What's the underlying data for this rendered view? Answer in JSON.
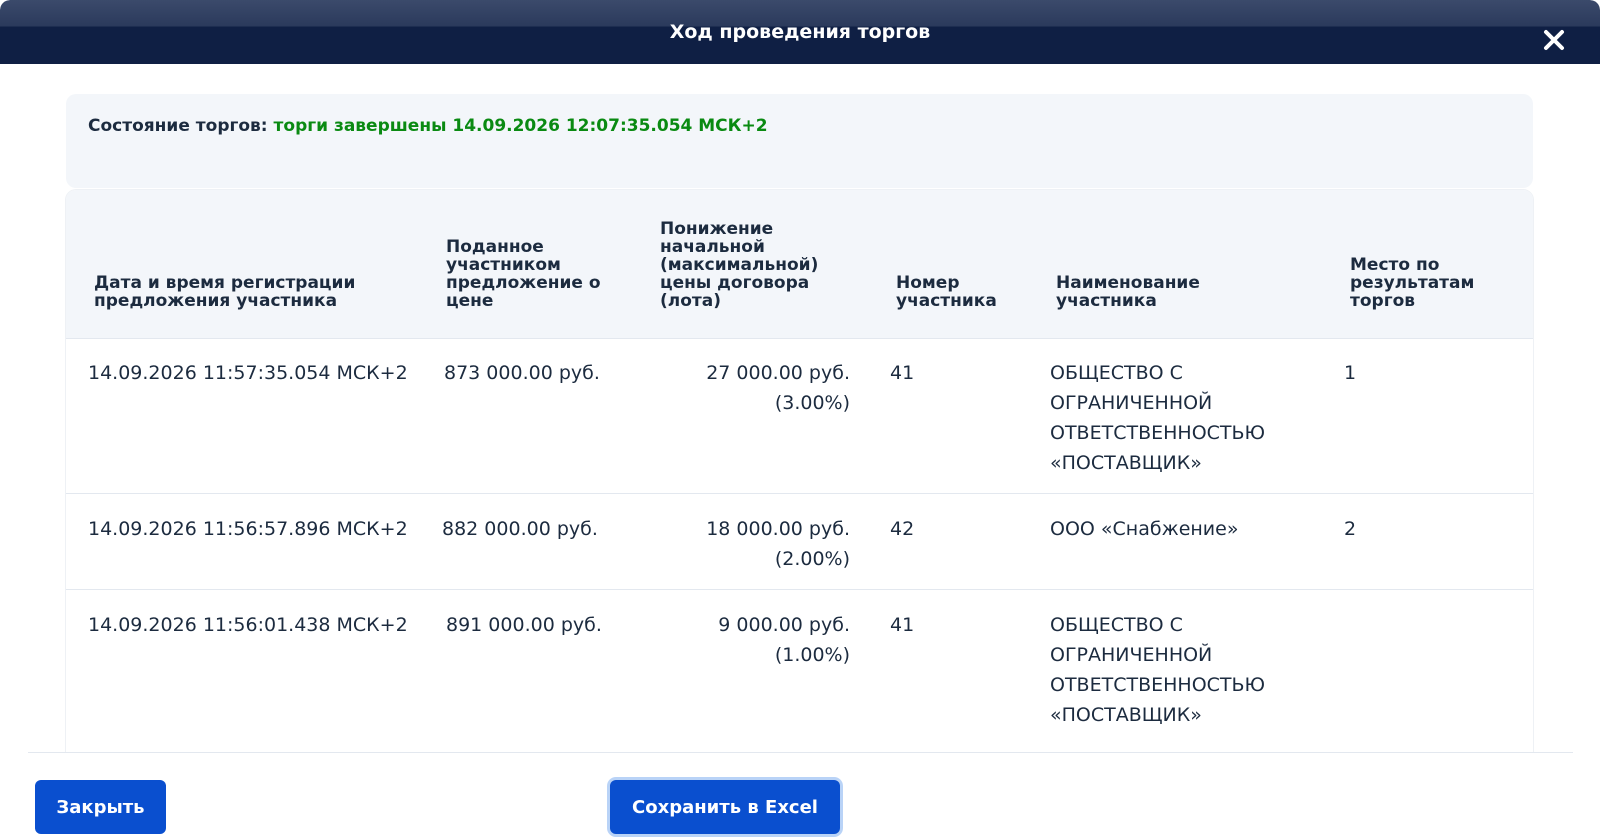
{
  "dialog": {
    "title": "Ход проведения торгов",
    "close_icon": "close-icon"
  },
  "status": {
    "label": "Состояние торгов:",
    "value": "торги завершены 14.09.2026 12:07:35.054 МСК+2",
    "value_color": "#0a8a12"
  },
  "table": {
    "headers": [
      "Дата и время регистрации предложения участника",
      "Поданное участником предложение о цене",
      "Понижение начальной (максимальной) цены договора (лота)",
      "Номер участника",
      "Наименование участника",
      "Место по результатам торгов"
    ],
    "rows": [
      {
        "datetime": "14.09.2026 11:57:35.054 МСК+2",
        "price": "873 000.00 руб.",
        "reduction": "27 000.00 руб.",
        "reduction_pct": "(3.00%)",
        "number": "41",
        "name_lines": [
          "ОБЩЕСТВО С",
          "ОГРАНИЧЕННОЙ",
          "ОТВЕТСТВЕННОСТЬЮ",
          "«ПОСТАВЩИК»"
        ],
        "place": "1"
      },
      {
        "datetime": "14.09.2026 11:56:57.896 МСК+2",
        "price": "882 000.00 руб.",
        "reduction": "18 000.00 руб.",
        "reduction_pct": "(2.00%)",
        "number": "42",
        "name_lines": [
          "ООО «Снабжение»"
        ],
        "place": "2"
      },
      {
        "datetime": "14.09.2026 11:56:01.438 МСК+2",
        "price": "891 000.00 руб.",
        "reduction": "9 000.00 руб.",
        "reduction_pct": "(1.00%)",
        "number": "41",
        "name_lines": [
          "ОБЩЕСТВО С",
          "ОГРАНИЧЕННОЙ",
          "ОТВЕТСТВЕННОСТЬЮ",
          "«ПОСТАВЩИК»"
        ],
        "place": ""
      }
    ]
  },
  "footer": {
    "close_label": "Закрыть",
    "excel_label": "Сохранить в Excel"
  },
  "colors": {
    "header_bg": "#0f1f44",
    "button_bg": "#0a4fcf",
    "card_bg": "#f3f6fa"
  }
}
